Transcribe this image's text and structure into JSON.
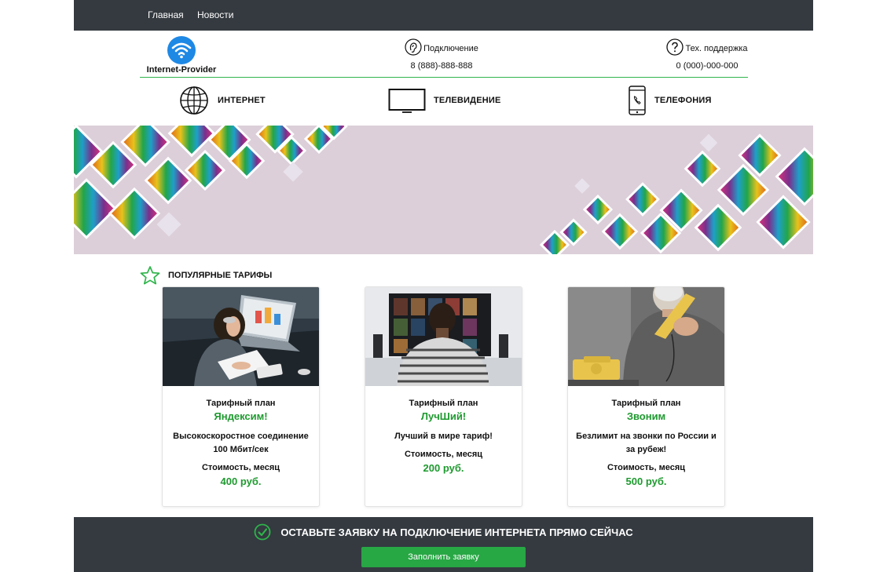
{
  "nav": {
    "items": [
      {
        "label": "Главная"
      },
      {
        "label": "Новости"
      }
    ]
  },
  "brand": {
    "name": "Internet-Provider",
    "icon": "wifi-icon",
    "color": "#1e88e5"
  },
  "contacts": {
    "connect": {
      "label": "Подключение",
      "phone": "8 (888)-888-888",
      "icon": "ear-icon"
    },
    "support": {
      "label": "Тех. поддержка",
      "phone": "0 (000)-000-000",
      "icon": "question-icon"
    }
  },
  "services": [
    {
      "label": "ИНТЕРНЕТ",
      "icon": "globe-icon"
    },
    {
      "label": "ТЕЛЕВИДЕНИЕ",
      "icon": "tv-icon"
    },
    {
      "label": "ТЕЛЕФОНИЯ",
      "icon": "smartphone-icon"
    }
  ],
  "section": {
    "title": "ПОПУЛЯРНЫЕ ТАРИФЫ",
    "icon": "star-icon"
  },
  "plans": [
    {
      "label": "Тарифный план",
      "name": "Яндексим!",
      "description": "Высокоскоростное соединение 100 Мбит/сек",
      "cost_label": "Стоимость, месяц",
      "price": "400 руб."
    },
    {
      "label": "Тарифный план",
      "name": "ЛучШий!",
      "description": "Лучший в мире тариф!",
      "cost_label": "Стоимость, месяц",
      "price": "200 руб."
    },
    {
      "label": "Тарифный план",
      "name": "Звоним",
      "description": "Безлимит на звонки по России и за рубеж!",
      "cost_label": "Стоимость, месяц",
      "price": "500 руб."
    }
  ],
  "cta": {
    "title": "ОСТАВЬТЕ ЗАЯВКУ НА ПОДКЛЮЧЕНИЕ ИНТЕРНЕТА ПРЯМО СЕЙЧАС",
    "button": "Заполнить заявку",
    "icon": "check-circle-icon"
  },
  "colors": {
    "accent": "#1e9a2f",
    "button": "#28a745",
    "dark": "#343a40",
    "banner_bg": "#dccfd9"
  }
}
